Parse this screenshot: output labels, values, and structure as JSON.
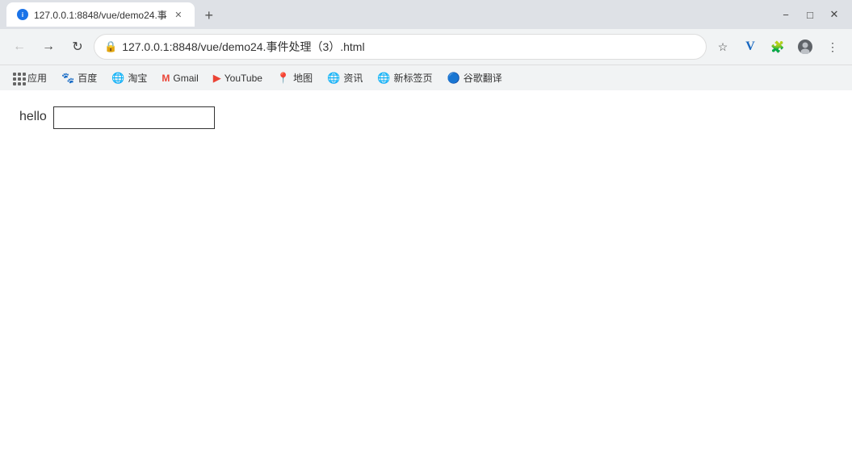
{
  "titlebar": {
    "tab": {
      "title": "127.0.0.1:8848/vue/demo24.事"
    },
    "new_tab_label": "+",
    "window_buttons": {
      "minimize": "−",
      "maximize": "□",
      "close": "✕"
    }
  },
  "navbar": {
    "back_label": "←",
    "forward_label": "→",
    "refresh_label": "↻",
    "address": "127.0.0.1:8848/vue/demo24.事件处理（3）.html",
    "star_label": "☆",
    "extensions": [
      "V",
      "🧩",
      "👤",
      "⋮"
    ]
  },
  "bookmarks": [
    {
      "id": "apps",
      "label": "应用",
      "icon": "grid"
    },
    {
      "id": "baidu",
      "label": "百度",
      "icon": "🐾"
    },
    {
      "id": "taobao",
      "label": "淘宝",
      "icon": "🌐"
    },
    {
      "id": "gmail",
      "label": "Gmail",
      "icon": "M"
    },
    {
      "id": "youtube",
      "label": "YouTube",
      "icon": "▶"
    },
    {
      "id": "maps",
      "label": "地图",
      "icon": "📍"
    },
    {
      "id": "news",
      "label": "资讯",
      "icon": "🌐"
    },
    {
      "id": "newtab",
      "label": "新标签页",
      "icon": "🌐"
    },
    {
      "id": "translate",
      "label": "谷歌翻译",
      "icon": "🔵"
    }
  ],
  "page": {
    "hello_label": "hello",
    "input_placeholder": ""
  }
}
